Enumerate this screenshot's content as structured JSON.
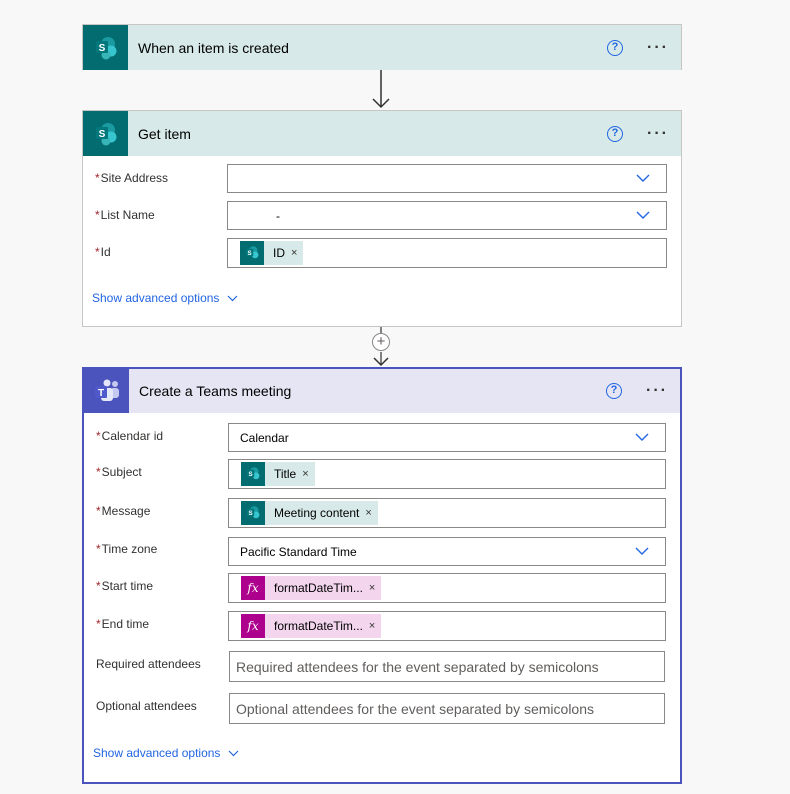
{
  "trigger": {
    "title": "When an item is created",
    "icon": "sharepoint-icon",
    "help": "?",
    "more": "···"
  },
  "get_item": {
    "title": "Get item",
    "icon": "sharepoint-icon",
    "help": "?",
    "more": "···",
    "fields": {
      "site_address": {
        "label": "Site Address",
        "required": "*",
        "value": ""
      },
      "list_name": {
        "label": "List Name",
        "required": "*",
        "value": "-"
      },
      "id": {
        "label": "Id",
        "required": "*",
        "token": "ID",
        "token_remove": "×"
      }
    },
    "advanced": "Show advanced options"
  },
  "add_step": {
    "icon": "plus-icon",
    "symbol": "+"
  },
  "teams_meeting": {
    "title": "Create a Teams meeting",
    "icon": "teams-icon",
    "help": "?",
    "more": "···",
    "fields": {
      "calendar_id": {
        "label": "Calendar id",
        "required": "*",
        "value": "Calendar"
      },
      "subject": {
        "label": "Subject",
        "required": "*",
        "token": "Title",
        "token_remove": "×"
      },
      "message": {
        "label": "Message",
        "required": "*",
        "token": "Meeting content",
        "token_remove": "×"
      },
      "time_zone": {
        "label": "Time zone",
        "required": "*",
        "value": "Pacific Standard Time"
      },
      "start_time": {
        "label": "Start time",
        "required": "*",
        "token": "formatDateTim...",
        "token_remove": "×",
        "fx": "fx"
      },
      "end_time": {
        "label": "End time",
        "required": "*",
        "token": "formatDateTim...",
        "token_remove": "×",
        "fx": "fx"
      },
      "required_attendees": {
        "label": "Required attendees",
        "placeholder": "Required attendees for the event separated by semicolons"
      },
      "optional_attendees": {
        "label": "Optional attendees",
        "placeholder": "Optional attendees for the event separated by semicolons"
      }
    },
    "advanced": "Show advanced options"
  },
  "colors": {
    "sharepoint": "#036c70",
    "teams": "#4b53bc",
    "link": "#2266e3",
    "required": "#a4262c",
    "fx_token": "#ad008c"
  }
}
